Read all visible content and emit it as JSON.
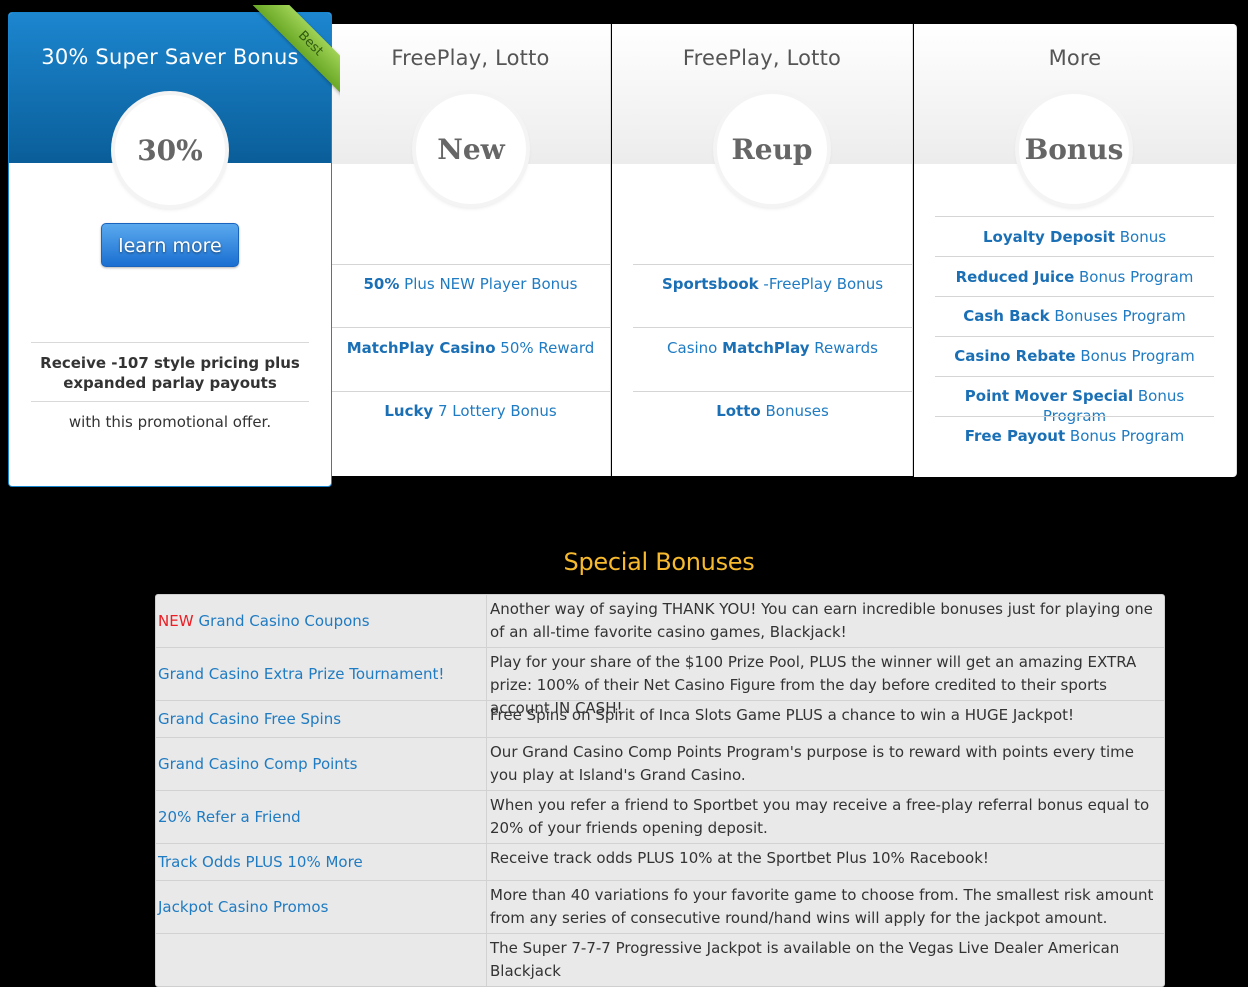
{
  "featured": {
    "title": "30% Super Saver Bonus",
    "ribbon": "Best",
    "badge": "30%",
    "button": "learn more",
    "line1": "Receive -107 style pricing plus expanded parlay payouts",
    "line2": "with this promotional offer."
  },
  "cards": [
    {
      "title": "FreePlay, Lotto",
      "badge": "New",
      "rows": [
        {
          "bold": "50%",
          "text": " Plus NEW Player Bonus"
        },
        {
          "bold": "MatchPlay Casino",
          "text": " 50% Reward"
        },
        {
          "bold": "Lucky",
          "text": " 7 Lottery Bonus"
        }
      ]
    },
    {
      "title": "FreePlay, Lotto",
      "badge": "Reup",
      "rows": [
        {
          "bold": "Sportsbook",
          "text": " -FreePlay Bonus"
        },
        {
          "pre": "Casino ",
          "bold": "MatchPlay",
          "text": " Rewards"
        },
        {
          "bold": "Lotto",
          "text": " Bonuses"
        }
      ]
    },
    {
      "title": "More",
      "badge": "Bonus",
      "rows": [
        {
          "bold": "Loyalty Deposit",
          "text": " Bonus"
        },
        {
          "bold": "Reduced Juice",
          "text": " Bonus Program"
        },
        {
          "bold": "Cash Back",
          "text": " Bonuses Program"
        },
        {
          "bold": "Casino Rebate",
          "text": " Bonus Program"
        },
        {
          "bold": "Point Mover Special",
          "text": " Bonus Program"
        },
        {
          "bold": "Free Payout",
          "text": " Bonus Program"
        }
      ]
    }
  ],
  "special": {
    "title": "Special Bonuses",
    "new_tag": "NEW",
    "rows": [
      {
        "name": "Grand Casino Coupons",
        "is_new": true,
        "desc": "Another way of saying THANK YOU! You can earn incredible bonuses just for playing one of an all-time favorite casino games, Blackjack!"
      },
      {
        "name": "Grand Casino Extra Prize Tournament!",
        "desc": "Play for your share of the $100 Prize Pool, PLUS the winner will get an amazing EXTRA prize: 100% of their Net Casino Figure from the day before credited to their sports account IN CASH!"
      },
      {
        "name": "Grand Casino Free Spins",
        "desc": "Free Spins on Spirit of Inca Slots Game PLUS a chance to win a HUGE Jackpot!"
      },
      {
        "name": "Grand Casino Comp Points",
        "desc": "Our Grand Casino Comp Points Program's purpose is to reward with points every time you play at Island's Grand Casino."
      },
      {
        "name": "20% Refer a Friend",
        "desc": "When you refer a friend to Sportbet you may receive a free-play referral bonus equal to 20% of your friends opening deposit."
      },
      {
        "name": "Track Odds PLUS 10% More",
        "desc": "Receive track odds PLUS 10% at the Sportbet Plus 10% Racebook!"
      },
      {
        "name": "Jackpot Casino Promos",
        "desc": "More than 40 variations fo your favorite game to choose from. The smallest risk amount from any series of consecutive round/hand wins will apply for the jackpot amount."
      },
      {
        "name": "",
        "desc": "The Super 7-7-7 Progressive Jackpot is available on the Vegas Live Dealer American Blackjack"
      }
    ]
  }
}
